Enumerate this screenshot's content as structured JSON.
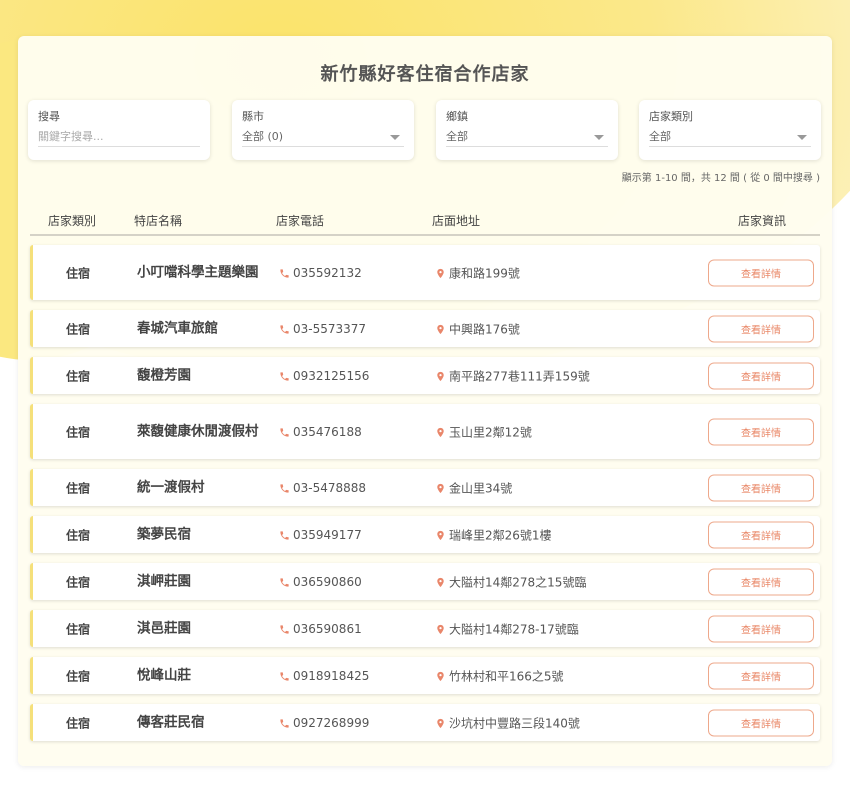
{
  "page": {
    "title": "新竹縣好客住宿合作店家"
  },
  "filters": {
    "search": {
      "label": "搜尋",
      "placeholder": "關鍵字搜尋..."
    },
    "county": {
      "label": "縣市",
      "value": "全部 (0)"
    },
    "township": {
      "label": "鄉鎮",
      "value": "全部"
    },
    "category": {
      "label": "店家類別",
      "value": "全部"
    }
  },
  "summary": "顯示第 1-10 間，共 12 間 ( 從 0 間中搜尋 )",
  "table": {
    "headers": {
      "type": "店家類別",
      "name": "特店名稱",
      "phone": "店家電話",
      "address": "店面地址",
      "info": "店家資訊"
    },
    "button_label": "查看詳情",
    "rows": [
      {
        "type": "住宿",
        "name": "小叮噹科學主題樂園",
        "phone": "035592132",
        "address": "康和路199號"
      },
      {
        "type": "住宿",
        "name": "春城汽車旅館",
        "phone": "03-5573377",
        "address": "中興路176號"
      },
      {
        "type": "住宿",
        "name": "馥橙芳園",
        "phone": "0932125156",
        "address": "南平路277巷111弄159號"
      },
      {
        "type": "住宿",
        "name": "萊馥健康休閒渡假村",
        "phone": "035476188",
        "address": "玉山里2鄰12號"
      },
      {
        "type": "住宿",
        "name": "統一渡假村",
        "phone": "03-5478888",
        "address": "金山里34號"
      },
      {
        "type": "住宿",
        "name": "築夢民宿",
        "phone": "035949177",
        "address": "瑞峰里2鄰26號1樓"
      },
      {
        "type": "住宿",
        "name": "淇岬莊園",
        "phone": "036590860",
        "address": "大隘村14鄰278之15號臨"
      },
      {
        "type": "住宿",
        "name": "淇邑莊園",
        "phone": "036590861",
        "address": "大隘村14鄰278-17號臨"
      },
      {
        "type": "住宿",
        "name": "悅峰山莊",
        "phone": "0918918425",
        "address": "竹林村和平166之5號"
      },
      {
        "type": "住宿",
        "name": "傳客莊民宿",
        "phone": "0927268999",
        "address": "沙坑村中豐路三段140號"
      }
    ]
  },
  "icons": {
    "phone": "phone-icon",
    "address": "map-pin-icon"
  },
  "colors": {
    "accent": "#e98868",
    "icon": "#e9866a",
    "row_border": "#f5e07a",
    "background_blob": "#fbe36a"
  }
}
